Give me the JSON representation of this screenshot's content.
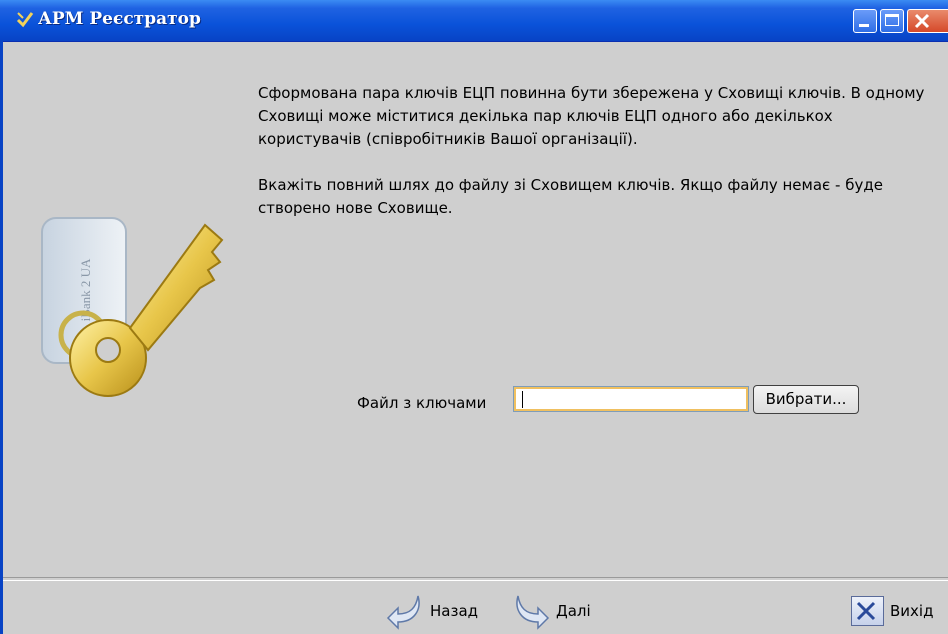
{
  "window": {
    "title": "АРМ Реєстратор"
  },
  "art": {
    "tag_text": "iBank 2 UA"
  },
  "instructions": {
    "paragraph1": "Сформована пара ключів ЕЦП повинна бути збережена у Сховищі ключів. В одному Сховищі може міститися декілька пар ключів ЕЦП одного або декількох користувачів (співробітників Вашої організації).",
    "paragraph2": "Вкажіть повний шлях до файлу зі Сховищем ключів. Якщо файлу немає - буде створено нове Сховище."
  },
  "file_field": {
    "label": "Файл з ключами",
    "value": "",
    "button_label": "Вибрати..."
  },
  "footer": {
    "back_label": "Назад",
    "next_label": "Далі",
    "exit_label": "Вихід"
  },
  "colors": {
    "titlebar": "#0a52d9",
    "background": "#cfcfcf",
    "key_gold": "#e8c64a"
  }
}
